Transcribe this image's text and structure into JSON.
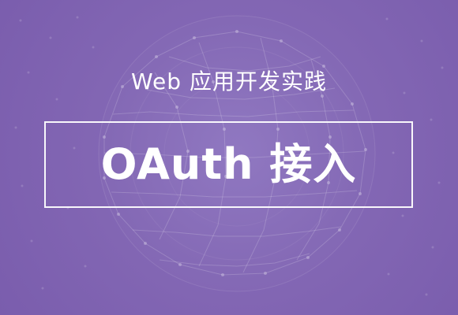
{
  "banner": {
    "subtitle": "Web 应用开发实践",
    "title": "OAuth 接入",
    "background_color": "#8468b5",
    "accent_color": "#ffffff"
  },
  "icons": {
    "background_graphic": "network-globe-icon"
  }
}
